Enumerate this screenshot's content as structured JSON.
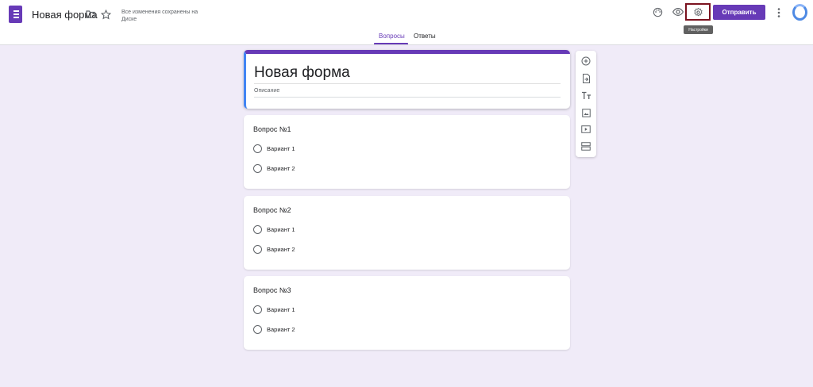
{
  "header": {
    "doc_title": "Новая форма",
    "save_status": "Все изменения сохранены на Диске",
    "send_label": "Отправить",
    "settings_tooltip": "Настройки",
    "icons": [
      "forms-logo-icon",
      "folder-icon",
      "star-icon",
      "palette-icon",
      "eye-icon",
      "gear-icon",
      "more-vert-icon",
      "avatar"
    ]
  },
  "tabs": [
    {
      "label": "Вопросы",
      "active": true
    },
    {
      "label": "Ответы",
      "active": false
    }
  ],
  "form": {
    "title": "Новая форма",
    "description_placeholder": "Описание"
  },
  "questions": [
    {
      "title": "Вопрос №1",
      "options": [
        "Вариант 1",
        "Вариант 2"
      ]
    },
    {
      "title": "Вопрос №2",
      "options": [
        "Вариант 1",
        "Вариант 2"
      ]
    },
    {
      "title": "Вопрос №3",
      "options": [
        "Вариант 1",
        "Вариант 2"
      ]
    }
  ],
  "toolbar": {
    "items": [
      "add-question-icon",
      "import-questions-icon",
      "add-title-icon",
      "add-image-icon",
      "add-video-icon",
      "add-section-icon"
    ]
  },
  "colors": {
    "accent": "#673ab7",
    "background": "#f0ebf8",
    "highlight": "#7b1320",
    "focus_border": "#4285f4"
  }
}
